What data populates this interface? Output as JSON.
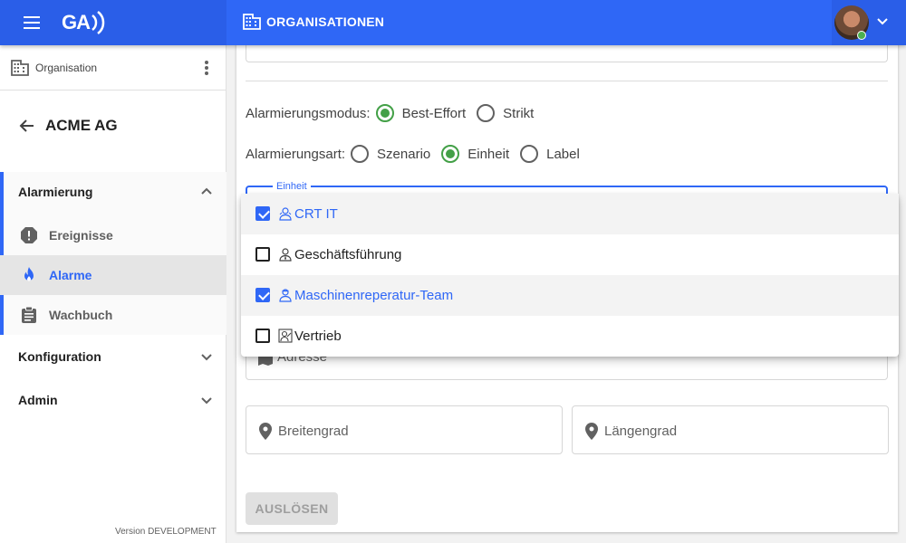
{
  "topbar": {
    "logo_text": "GA",
    "page_title": "ORGANISATIONEN"
  },
  "sidebar": {
    "org_label": "Organisation",
    "org_name": "ACME AG",
    "groups": [
      {
        "label": "Alarmierung",
        "expanded": true,
        "items": [
          {
            "label": "Ereignisse",
            "icon": "exclamation-circle-icon"
          },
          {
            "label": "Alarme",
            "icon": "flame-icon",
            "selected": true
          },
          {
            "label": "Wachbuch",
            "icon": "clipboard-icon"
          }
        ]
      },
      {
        "label": "Konfiguration",
        "expanded": false
      },
      {
        "label": "Admin",
        "expanded": false
      }
    ],
    "version": "Version DEVELOPMENT"
  },
  "form": {
    "modus": {
      "label": "Alarmierungsmodus:",
      "options": [
        "Best-Effort",
        "Strikt"
      ],
      "selected": "Best-Effort"
    },
    "art": {
      "label": "Alarmierungsart:",
      "options": [
        "Szenario",
        "Einheit",
        "Label"
      ],
      "selected": "Einheit"
    },
    "einheit": {
      "legend": "Einheit",
      "options": [
        {
          "label": "CRT IT",
          "checked": true
        },
        {
          "label": "Geschäftsführung",
          "checked": false
        },
        {
          "label": "Maschinenreperatur-Team",
          "checked": true
        },
        {
          "label": "Vertrieb",
          "checked": false
        }
      ]
    },
    "adresse_placeholder": "Adresse",
    "breitengrad_placeholder": "Breitengrad",
    "laengengrad_placeholder": "Längengrad",
    "submit_label": "AUSLÖSEN"
  },
  "colors": {
    "primary": "#2f67f6",
    "radio_green": "#43a047",
    "online": "#4caf50"
  }
}
